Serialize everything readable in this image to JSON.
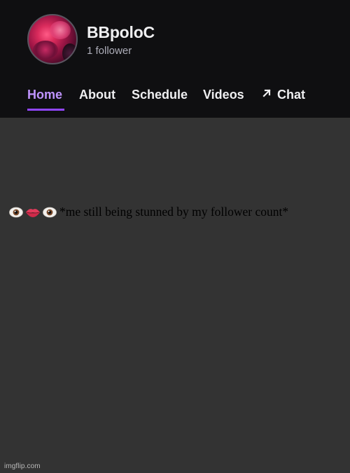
{
  "channel": {
    "name": "BBpoloC",
    "followers": "1 follower"
  },
  "nav": {
    "tabs": [
      "Home",
      "About",
      "Schedule",
      "Videos",
      "Chat"
    ],
    "active": "Home",
    "chat_icon": "arrow-up-right-icon"
  },
  "caption": {
    "emojis": [
      "eye",
      "lips",
      "eye"
    ],
    "text": "*me still being stunned by my follower count*"
  },
  "watermark": "imgflip.com",
  "colors": {
    "header_bg": "#0f0f11",
    "body_bg": "#333333",
    "accent": "#9146ff",
    "active_tab": "#bf94ff",
    "text_primary": "#efeff1",
    "text_secondary": "#adadb8"
  }
}
